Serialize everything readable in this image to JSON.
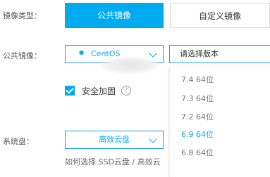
{
  "image_type": {
    "label": "镜像类型：",
    "tabs": [
      {
        "label": "公共镜像",
        "active": true
      },
      {
        "label": "自定义镜像",
        "active": false
      }
    ]
  },
  "public_image": {
    "label": "公共镜像：",
    "os_value": "CentOS",
    "version_placeholder": "请选择版本",
    "version_options": [
      "7.4 64位",
      "7.3 64位",
      "7.2 64位",
      "6.9 64位",
      "6.8 64位"
    ],
    "highlighted_option": "6.9 64位"
  },
  "security": {
    "label": "安全加固",
    "checked": true
  },
  "system_disk": {
    "label": "系统盘：",
    "value": "高效云盘",
    "hint": "如何选择 SSD云盘 / 高效云"
  },
  "colors": {
    "accent": "#00aaf0",
    "border": "#1e9cf0"
  }
}
